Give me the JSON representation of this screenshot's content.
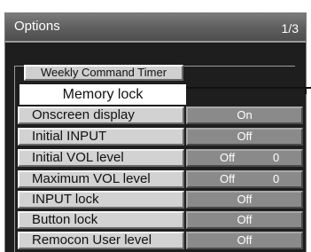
{
  "header": {
    "title": "Options",
    "page": "1/3"
  },
  "menu": {
    "weekly_command_timer": "Weekly Command Timer",
    "memory_lock": "Memory lock",
    "rows": [
      {
        "label": "Onscreen display",
        "value": "On"
      },
      {
        "label": "Initial INPUT",
        "value": "Off"
      },
      {
        "label": "Initial VOL level",
        "state": "Off",
        "level": "0"
      },
      {
        "label": "Maximum VOL level",
        "state": "Off",
        "level": "0"
      },
      {
        "label": "INPUT lock",
        "value": "Off"
      },
      {
        "label": "Button lock",
        "value": "Off"
      },
      {
        "label": "Remocon User level",
        "value": "Off"
      }
    ]
  },
  "colors": {
    "panel_background": "#1e1e1e",
    "label_background": "#d2d2d2",
    "value_background": "#8a8a8a",
    "selected_background": "#ffffff"
  }
}
